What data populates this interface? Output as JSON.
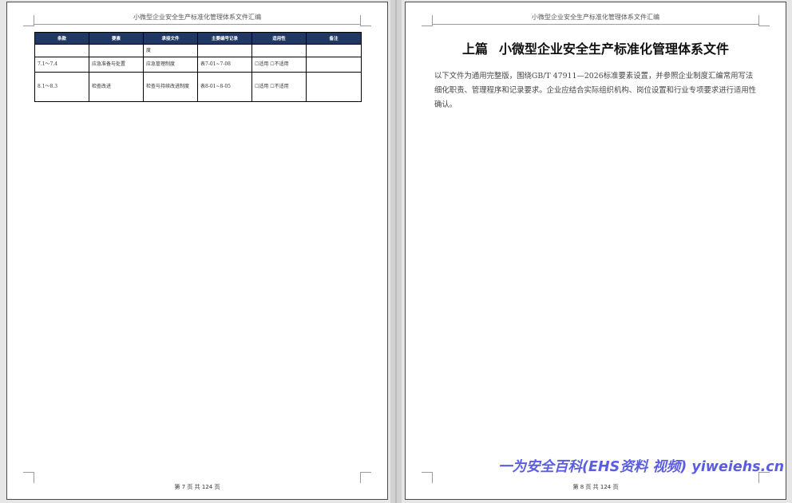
{
  "document": {
    "header_text": "小微型企业安全生产标准化管理体系文件汇编"
  },
  "left_page": {
    "footer_text": "第 7 页 共 124 页",
    "table": {
      "columns": [
        "条款",
        "要素",
        "承接文件",
        "主要编号记录",
        "适用性",
        "备注"
      ],
      "rows": [
        [
          "",
          "",
          "度",
          "",
          "",
          ""
        ],
        [
          "7.1～7.4",
          "应急准备与处置",
          "应急管理制度",
          "表7-01~7-08",
          "☐适用 ☐不适用",
          ""
        ],
        [
          "8.1～8.3",
          "检查改进",
          "检查与持续改进制度",
          "表8-01~8-05",
          "☐适用 ☐不适用",
          ""
        ]
      ]
    }
  },
  "right_page": {
    "title_part": "上篇",
    "title_text": "小微型企业安全生产标准化管理体系文件",
    "body_text": "以下文件为通用完整版，围绕GB/T 47911—2026标准要素设置，并参照企业制度汇编常用写法细化职责、管理程序和记录要求。企业应结合实际组织机构、岗位设置和行业专项要求进行适用性确认。",
    "footer_text": "第 8 页 共 124 页"
  },
  "watermark": "一为安全百科(EHS资料 视频) yiweiehs.cn"
}
